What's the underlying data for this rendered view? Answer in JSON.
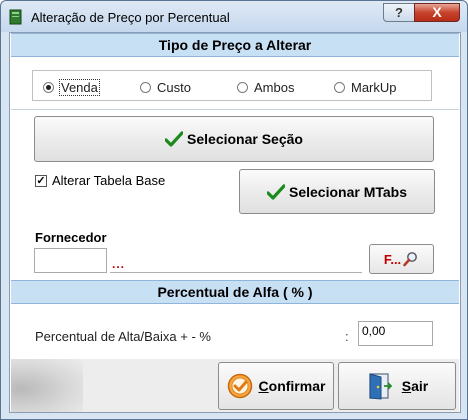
{
  "window": {
    "title": "Alteração de Preço por Percentual",
    "help_label": "?",
    "close_label": "X"
  },
  "price_type": {
    "header": "Tipo de Preço a Alterar",
    "options": [
      {
        "label": "Venda",
        "checked": true
      },
      {
        "label": "Custo",
        "checked": false
      },
      {
        "label": "Ambos",
        "checked": false
      },
      {
        "label": "MarkUp",
        "checked": false
      }
    ]
  },
  "actions": {
    "select_section_label": "Selecionar Seção",
    "alter_base_table_label": "Alterar Tabela Base",
    "alter_base_table_checked": true,
    "alter_base_table_mark": "✓",
    "select_mtabs_label": "Selecionar MTabs"
  },
  "supplier": {
    "label": "Fornecedor",
    "code_value": "",
    "name_placeholder": "...",
    "find_button_label": "F..."
  },
  "percent": {
    "header": "Percentual de Alfa ( % )",
    "field_label": "Percentual de Alta/Baixa + -  %",
    "colon": ":",
    "value": "0,00"
  },
  "footer": {
    "confirm_first": "C",
    "confirm_rest": "onfirmar",
    "exit_first": "S",
    "exit_rest": "air"
  },
  "colors": {
    "header_bg": "#c8e0f4",
    "accent_red": "#c00000",
    "check_green": "#1b8a1b",
    "confirm_orange": "#e8891e"
  }
}
